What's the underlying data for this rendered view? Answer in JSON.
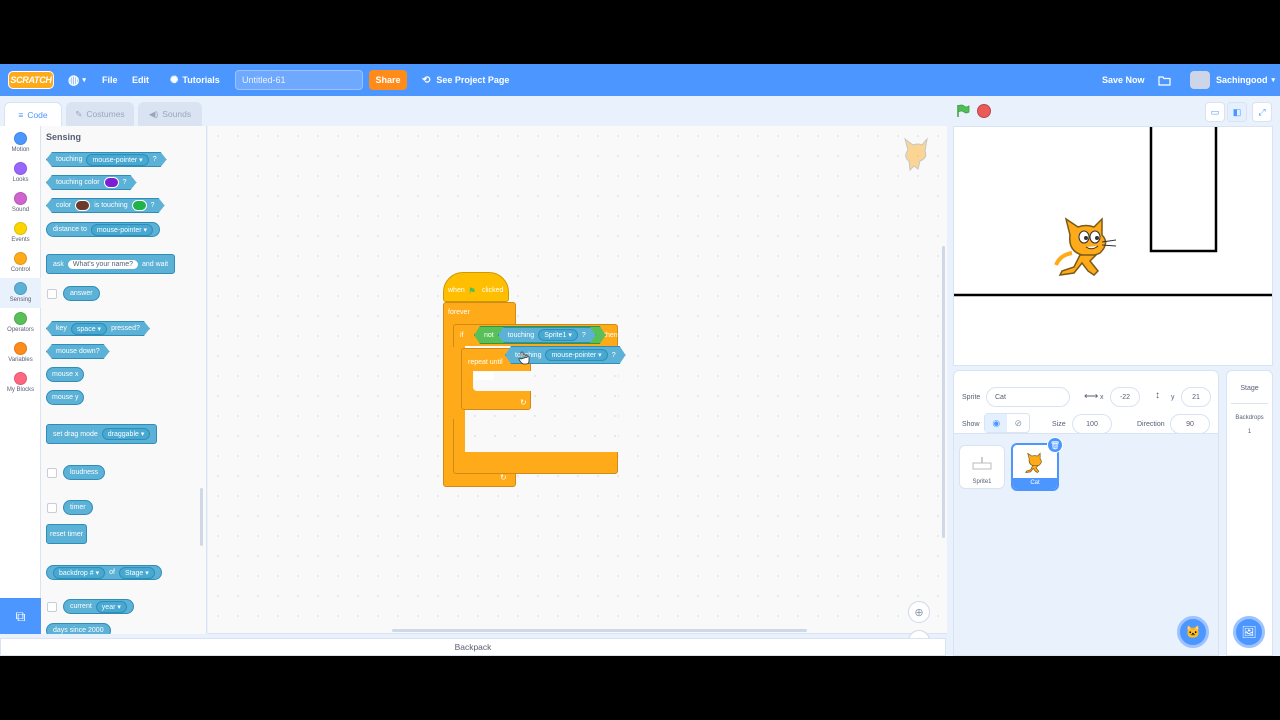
{
  "menu": {
    "logo": "SCRATCH",
    "file": "File",
    "edit": "Edit",
    "tutorials": "Tutorials",
    "project_title": "Untitled-61",
    "share": "Share",
    "see_project_page": "See Project Page",
    "save_now": "Save Now",
    "username": "Sachingood"
  },
  "tabs": {
    "code": "Code",
    "costumes": "Costumes",
    "sounds": "Sounds"
  },
  "categories": [
    {
      "label": "Motion",
      "color": "#4c97ff"
    },
    {
      "label": "Looks",
      "color": "#9966ff"
    },
    {
      "label": "Sound",
      "color": "#cf63cf"
    },
    {
      "label": "Events",
      "color": "#ffd500"
    },
    {
      "label": "Control",
      "color": "#ffab19"
    },
    {
      "label": "Sensing",
      "color": "#5cb1d6"
    },
    {
      "label": "Operators",
      "color": "#59c059"
    },
    {
      "label": "Variables",
      "color": "#ff8c1a"
    },
    {
      "label": "My Blocks",
      "color": "#ff6680"
    }
  ],
  "palette": {
    "heading": "Sensing",
    "touching": "touching",
    "mouse_pointer": "mouse-pointer",
    "q": "?",
    "touching_color": "touching color",
    "color": "color",
    "is_touching": "is touching",
    "distance_to": "distance to",
    "ask": "ask",
    "whats_your_name": "What's your name?",
    "and_wait": "and wait",
    "answer": "answer",
    "key": "key",
    "space": "space",
    "pressed": "pressed?",
    "mouse_down": "mouse down?",
    "mouse_x": "mouse x",
    "mouse_y": "mouse y",
    "set_drag_mode": "set drag mode",
    "draggable": "draggable",
    "loudness": "loudness",
    "timer": "timer",
    "reset_timer": "reset timer",
    "backdrop_num": "backdrop #",
    "of": "of",
    "stage": "Stage",
    "current": "current",
    "year": "year",
    "days_since": "days since 2000"
  },
  "script": {
    "when": "when",
    "clicked": "clicked",
    "forever": "forever",
    "if": "if",
    "not": "not",
    "touching": "touching",
    "sprite1": "Sprite1",
    "q": "?",
    "then": "then",
    "repeat_until": "repeat until",
    "dragged_touching": "touching",
    "dragged_target": "mouse-pointer"
  },
  "stage_colors": {
    "green_flag": "#4cbf56",
    "stop": "#ec5959"
  },
  "sprite_info": {
    "sprite_label": "Sprite",
    "sprite_name": "Cat",
    "x_label": "x",
    "x_value": "-22",
    "y_label": "y",
    "y_value": "21",
    "show_label": "Show",
    "size_label": "Size",
    "size_value": "100",
    "direction_label": "Direction",
    "direction_value": "90"
  },
  "sprites": [
    {
      "name": "Sprite1",
      "selected": false
    },
    {
      "name": "Cat",
      "selected": true
    }
  ],
  "stage_panel": {
    "title": "Stage",
    "backdrops_label": "Backdrops",
    "backdrops_count": "1"
  },
  "backpack": "Backpack"
}
